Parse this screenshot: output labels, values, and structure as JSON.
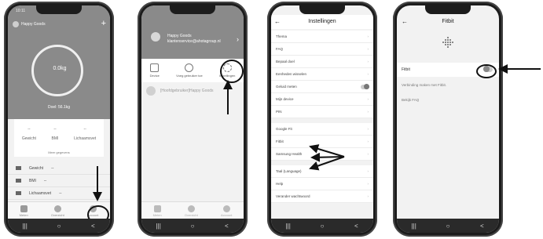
{
  "phone1": {
    "status_time": "10:11",
    "user_name": "Happy Goods",
    "weight_value": "0.0kg",
    "goal": "Doel: 56.1kg",
    "stats": [
      {
        "value": "--",
        "label": "Gewicht"
      },
      {
        "value": "--",
        "label": "BMI"
      },
      {
        "value": "--",
        "label": "Lichaamsvet"
      }
    ],
    "more": "Meer gegevens",
    "list": [
      {
        "label": "Gewicht",
        "value": "--"
      },
      {
        "label": "BMI",
        "value": "--"
      },
      {
        "label": "Lichaamsvet",
        "value": "--"
      }
    ],
    "tabs": [
      "Meten",
      "Overzicht",
      "Account"
    ]
  },
  "phone2": {
    "name": "Happy Goods",
    "email": "klantenservice@ahotagroup.nl",
    "icons": [
      "Device",
      "Voeg gebruiker toe",
      "Instellingen"
    ],
    "user_row": "[Hoofdgebruiker]Happy Goods",
    "tabs": [
      "Meten",
      "Overzicht",
      "Account"
    ]
  },
  "phone3": {
    "title": "Instellingen",
    "groups": [
      [
        "Thema",
        "FAQ",
        "Bepaal doel",
        "Eenheden wisselen",
        "Geluid meten",
        "Mijn device",
        "PIN"
      ],
      [
        "Google Fit",
        "Fitbit",
        "Samsung Health"
      ],
      [
        "Taal (Language)",
        "Help",
        "Verander wachtwoord"
      ]
    ]
  },
  "phone4": {
    "title": "Fitbit",
    "row_label": "Fitbit",
    "desc": "Verbinding maken met Fitbit.",
    "faq": "Bekijk FAQ"
  },
  "nav_glyphs": [
    "|||",
    "○",
    "<"
  ]
}
